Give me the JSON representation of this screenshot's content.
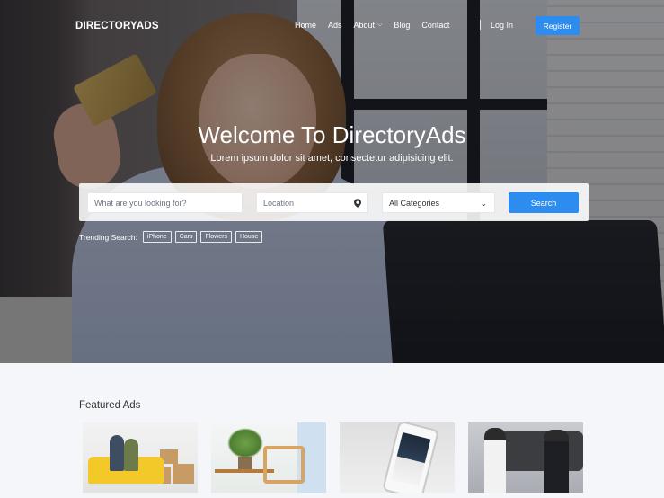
{
  "nav": {
    "brand": "DIRECTORYADS",
    "items": [
      {
        "label": "Home"
      },
      {
        "label": "Ads"
      },
      {
        "label": "About",
        "has_dropdown": true
      },
      {
        "label": "Blog"
      },
      {
        "label": "Contact"
      }
    ],
    "login": "Log In",
    "register": "Register"
  },
  "hero": {
    "title": "Welcome To DirectoryAds",
    "subtitle": "Lorem ipsum dolor sit amet, consectetur adipisicing elit."
  },
  "search": {
    "what_placeholder": "What are you looking for?",
    "location_placeholder": "Location",
    "category_selected": "All Categories",
    "button": "Search",
    "location_icon": "map-pin-icon",
    "category_icon": "chevron-down-icon"
  },
  "trending": {
    "label": "Trending Search:",
    "tags": [
      "iPhone",
      "Cars",
      "Flowers",
      "House"
    ]
  },
  "featured": {
    "title": "Featured Ads"
  },
  "colors": {
    "accent": "#2d8cf0",
    "page_bg": "#f4f6f9"
  }
}
